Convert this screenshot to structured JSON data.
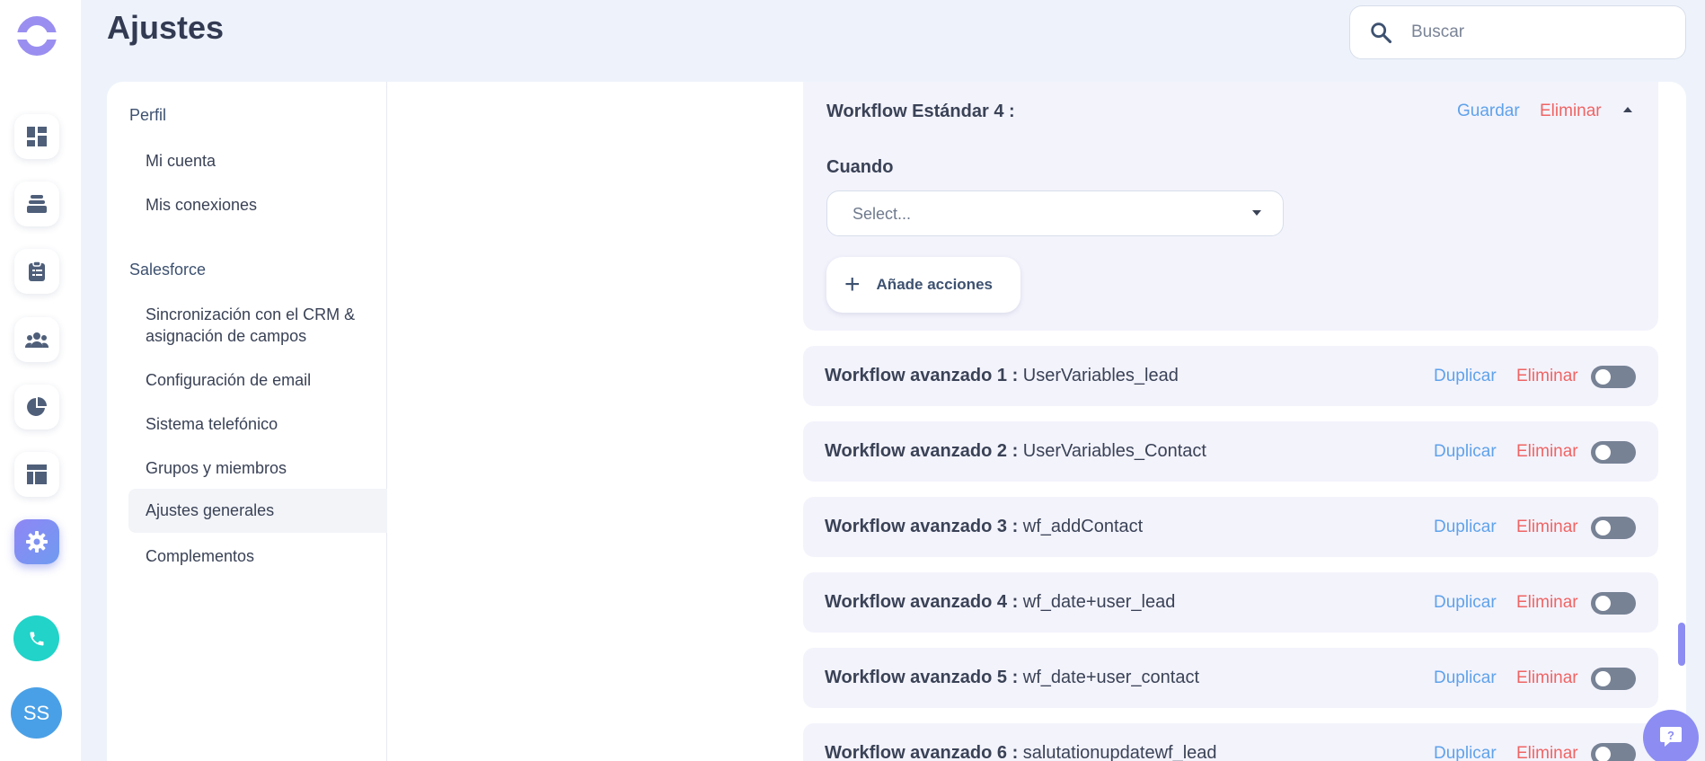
{
  "page": {
    "title": "Ajustes"
  },
  "search": {
    "placeholder": "Buscar"
  },
  "user": {
    "initials": "SS"
  },
  "rail": {
    "items": [
      {
        "icon": "dashboard-icon"
      },
      {
        "icon": "inbox-icon"
      },
      {
        "icon": "clipboard-icon"
      },
      {
        "icon": "team-icon"
      },
      {
        "icon": "pie-chart-icon"
      },
      {
        "icon": "layout-icon"
      },
      {
        "icon": "gear-icon",
        "active": true
      }
    ]
  },
  "settings_nav": {
    "sections": [
      {
        "title": "Perfil",
        "items": [
          "Mi cuenta",
          "Mis conexiones"
        ]
      },
      {
        "title": "Salesforce",
        "items": [
          "Sincronización con el CRM & asignación de campos",
          "Configuración de email",
          "Sistema telefónico",
          "Grupos y miembros",
          "Ajustes generales",
          "Complementos"
        ]
      }
    ],
    "selected": "Ajustes generales"
  },
  "standard_workflow": {
    "title": "Workflow Estándar 4 :",
    "save_label": "Guardar",
    "delete_label": "Eliminar",
    "when_label": "Cuando",
    "select_placeholder": "Select...",
    "add_actions_label": "Añade acciones"
  },
  "advanced_workflows": {
    "duplicate_label": "Duplicar",
    "delete_label": "Eliminar",
    "items": [
      {
        "label": "Workflow avanzado 1 :",
        "name": "UserVariables_lead",
        "enabled": false
      },
      {
        "label": "Workflow avanzado 2 :",
        "name": "UserVariables_Contact",
        "enabled": false
      },
      {
        "label": "Workflow avanzado 3 :",
        "name": "wf_addContact",
        "enabled": false
      },
      {
        "label": "Workflow avanzado 4 :",
        "name": "wf_date+user_lead",
        "enabled": false
      },
      {
        "label": "Workflow avanzado 5 :",
        "name": "wf_date+user_contact",
        "enabled": false
      },
      {
        "label": "Workflow avanzado 6 :",
        "name": "salutationupdatewf_lead",
        "enabled": false
      }
    ]
  },
  "colors": {
    "accent": "#8c8cf3",
    "link_blue": "#5fa2ea",
    "danger": "#ef6464",
    "phone": "#21d3c8",
    "card_bg": "#f3f3fc"
  }
}
